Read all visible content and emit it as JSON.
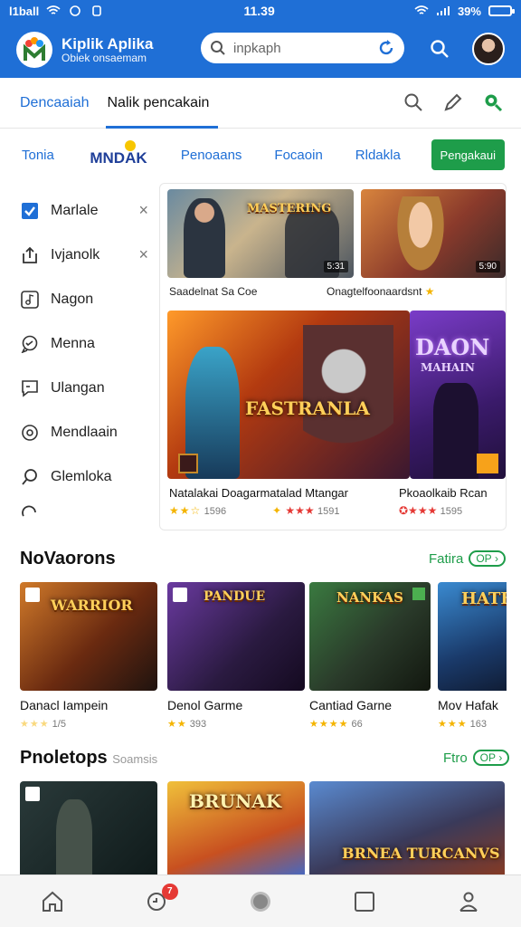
{
  "statusbar": {
    "left_text": "l1ball",
    "time": "11.39",
    "battery": "39%"
  },
  "header": {
    "app_name": "Kiplik Aplika",
    "app_sub": "Obiek onsaemam",
    "search_placeholder": "inpkaph"
  },
  "tabs": [
    {
      "label": "Dencaaiah"
    },
    {
      "label": "Nalik pencakain"
    }
  ],
  "subnav": {
    "items": [
      "Tonia",
      "Penoaans",
      "Focaoin",
      "Rldakla"
    ],
    "logo_text": "MNDAK",
    "cta": "Pengakaui"
  },
  "sidebar": {
    "items": [
      {
        "label": "Marlale",
        "icon": "checkbox-icon"
      },
      {
        "label": "Ivjanolk",
        "icon": "share-icon"
      },
      {
        "label": "Nagon",
        "icon": "music-icon"
      },
      {
        "label": "Menna",
        "icon": "chat-icon"
      },
      {
        "label": "Ulangan",
        "icon": "message-icon"
      },
      {
        "label": "Mendlaain",
        "icon": "target-icon"
      },
      {
        "label": "Glemloka",
        "icon": "search-icon"
      }
    ]
  },
  "featured": {
    "top": [
      {
        "badge": "5:31",
        "caption": "Saadelnat Sa Coe",
        "art": "MASTERING"
      },
      {
        "badge": "5:90",
        "caption": "Onagtelfoonaardsnt"
      }
    ],
    "big": {
      "title": "Natalakai Doagarmatalad Mtangar",
      "art": "FASTRANLA",
      "rating": "1596",
      "rating2": "1591"
    },
    "side": {
      "title": "Pkoaolkaib Rcan",
      "art_top": "DAON",
      "art_sub": "MAHAIN",
      "rating": "1595"
    }
  },
  "section1": {
    "title": "NoVaorons",
    "link": "Fatira",
    "pill": "OP",
    "cards": [
      {
        "title": "Danacl Iampein",
        "rating": "1/5",
        "art": "WARRIOR"
      },
      {
        "title": "Denol Garme",
        "rating": "393",
        "art": "PANDUE"
      },
      {
        "title": "Cantiad Garne",
        "rating": "66",
        "art": "NANKAS"
      },
      {
        "title": "Mov Hafak",
        "rating": "163",
        "art": "HATE"
      }
    ]
  },
  "section2": {
    "title": "Pnoletops",
    "subtitle": "Soamsis",
    "link": "Ftro",
    "pill": "OP",
    "cards": [
      {
        "art": ""
      },
      {
        "art": "BRUNAK"
      },
      {
        "art": "BRNEA TURCANVS"
      }
    ]
  },
  "bottom_nav": {
    "badge": "7",
    "items": [
      "home-icon",
      "games-icon",
      "record-icon",
      "library-icon",
      "profile-icon"
    ]
  }
}
